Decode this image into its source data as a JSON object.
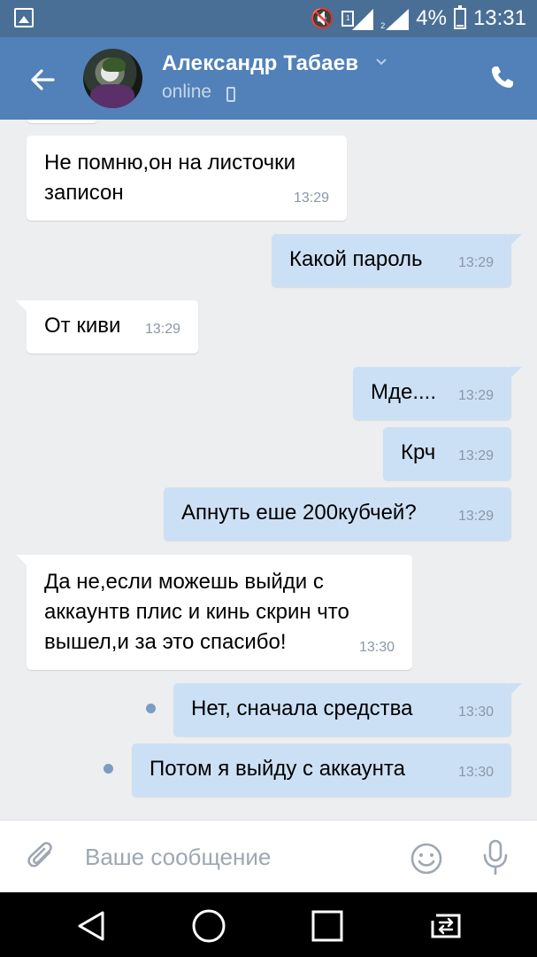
{
  "status_bar": {
    "battery": "4%",
    "time": "13:31",
    "network": "4G+"
  },
  "header": {
    "name": "Александр Табаев",
    "status": "online"
  },
  "messages": [
    {
      "text_lines": [
        "Не помню,он на листочки",
        "записон"
      ],
      "time": "13:29",
      "direction": "in"
    },
    {
      "text_lines": [
        "Какой пароль"
      ],
      "time": "13:29",
      "direction": "out"
    },
    {
      "text_lines": [
        "От киви"
      ],
      "time": "13:29",
      "direction": "in"
    },
    {
      "text_lines": [
        "Мде...."
      ],
      "time": "13:29",
      "direction": "out"
    },
    {
      "text_lines": [
        "Крч"
      ],
      "time": "13:29",
      "direction": "out"
    },
    {
      "text_lines": [
        "Апнуть еше 200кубчей?"
      ],
      "time": "13:29",
      "direction": "out"
    },
    {
      "text_lines": [
        "Да не,если можешь выйди с",
        "аккаунтв плис и кинь скрин что",
        "вышел,и за это спасибо!"
      ],
      "time": "13:30",
      "direction": "in"
    },
    {
      "text_lines": [
        "Нет, сначала средства"
      ],
      "time": "13:30",
      "direction": "out",
      "unread": true
    },
    {
      "text_lines": [
        "Потом я выйду с аккаунта"
      ],
      "time": "13:30",
      "direction": "out",
      "unread": true
    }
  ],
  "compose": {
    "placeholder": "Ваше сообщение"
  },
  "colors": {
    "header": "#5181b8",
    "status_bar": "#4a6f96",
    "outgoing_bubble": "#cce0f5",
    "incoming_bubble": "#ffffff",
    "chat_background": "#edeef0"
  },
  "icons": [
    "back-arrow-icon",
    "phone-icon",
    "mobile-icon",
    "attach-icon",
    "emoji-icon",
    "mic-icon",
    "nav-back-icon",
    "nav-home-icon",
    "nav-recents-icon",
    "nav-switch-icon"
  ]
}
